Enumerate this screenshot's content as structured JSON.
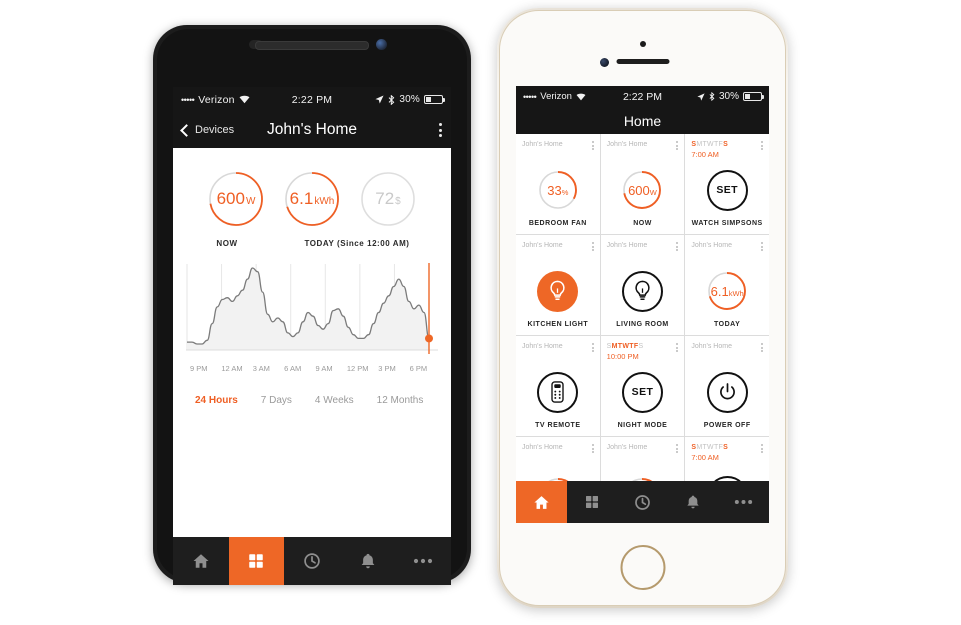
{
  "accent": "#ee6726",
  "android": {
    "status": {
      "carrier_dots": "•••••",
      "carrier": "Verizon",
      "time": "2:22 PM",
      "battery": "30%"
    },
    "header": {
      "back_label": "Devices",
      "title": "John's Home",
      "menu_icon": "kebab-menu-icon"
    },
    "gauges": [
      {
        "value": "600",
        "unit": "W",
        "pct": 72,
        "style": "orange"
      },
      {
        "value": "6.1",
        "unit": "kWh",
        "pct": 70,
        "style": "orange"
      },
      {
        "value": "72",
        "unit": "$",
        "pct": 0,
        "style": "grey"
      }
    ],
    "gauge_labels": {
      "now": "NOW",
      "today": "TODAY (Since 12:00 AM)"
    },
    "ranges": [
      {
        "label": "24 Hours",
        "active": true
      },
      {
        "label": "7 Days",
        "active": false
      },
      {
        "label": "4 Weeks",
        "active": false
      },
      {
        "label": "12 Months",
        "active": false
      }
    ],
    "tabs": [
      {
        "icon": "home-icon",
        "active": false
      },
      {
        "icon": "grid-icon",
        "active": true
      },
      {
        "icon": "clock-icon",
        "active": false
      },
      {
        "icon": "bell-icon",
        "active": false
      },
      {
        "icon": "ellipsis-icon",
        "active": false
      }
    ]
  },
  "chart_data": {
    "type": "area",
    "title": "",
    "xlabel": "",
    "ylabel": "",
    "grid": true,
    "legend": null,
    "tick_labels": [
      "9 PM",
      "12 AM",
      "3 AM",
      "6 AM",
      "9 AM",
      "12 PM",
      "3 PM",
      "6 PM"
    ],
    "ylim": [
      0,
      100
    ],
    "marker": {
      "x_label": "6 PM",
      "value": 44,
      "color": "#ee6726"
    },
    "x": [
      0,
      1,
      2,
      3,
      4,
      5,
      6,
      7,
      8,
      9,
      10,
      11,
      12,
      13,
      14,
      15,
      16,
      17,
      18,
      19,
      20,
      21,
      22,
      23,
      24,
      25,
      26,
      27,
      28,
      29,
      30,
      31,
      32,
      33,
      34,
      35,
      36,
      37,
      38,
      39,
      40,
      41,
      42,
      43,
      44,
      45,
      46,
      47,
      48
    ],
    "values": [
      42,
      42,
      41,
      41,
      43,
      52,
      61,
      65,
      66,
      64,
      67,
      70,
      76,
      82,
      80,
      69,
      57,
      53,
      55,
      53,
      47,
      45,
      47,
      53,
      58,
      56,
      51,
      49,
      52,
      59,
      60,
      56,
      50,
      46,
      44,
      44,
      46,
      52,
      58,
      63,
      67,
      72,
      76,
      72,
      64,
      60,
      62,
      58,
      44
    ]
  },
  "iphone": {
    "status": {
      "carrier_dots": "•••••",
      "carrier": "Verizon",
      "time": "2:22 PM",
      "battery": "30%"
    },
    "header": {
      "title": "Home"
    },
    "tiles": [
      {
        "source": "John's Home",
        "name": "BEDROOM FAN",
        "kind": "gauge",
        "value": "33",
        "unit": "%",
        "pct": 33,
        "style": "orange"
      },
      {
        "source": "John's Home",
        "name": "NOW",
        "kind": "gauge",
        "value": "600",
        "unit": "W",
        "pct": 72,
        "style": "orange"
      },
      {
        "schedule": {
          "days": [
            "S",
            "M",
            "T",
            "W",
            "T",
            "F",
            "S"
          ],
          "active": [
            true,
            false,
            false,
            false,
            false,
            false,
            true
          ],
          "time": "7:00 AM"
        },
        "name": "WATCH SIMPSONS",
        "kind": "set"
      },
      {
        "source": "John's Home",
        "name": "KITCHEN LIGHT",
        "kind": "bulb",
        "state": "on"
      },
      {
        "source": "John's Home",
        "name": "LIVING ROOM",
        "kind": "bulb",
        "state": "off"
      },
      {
        "source": "John's Home",
        "name": "TODAY",
        "kind": "gauge",
        "value": "6.1",
        "unit": "kWh",
        "pct": 70,
        "style": "orange"
      },
      {
        "source": "John's Home",
        "name": "TV REMOTE",
        "kind": "remote"
      },
      {
        "schedule": {
          "days": [
            "S",
            "M",
            "T",
            "W",
            "T",
            "F",
            "S"
          ],
          "active": [
            false,
            true,
            true,
            true,
            true,
            true,
            false
          ],
          "time": "10:00 PM"
        },
        "name": "NIGHT MODE",
        "kind": "set"
      },
      {
        "source": "John's Home",
        "name": "POWER OFF",
        "kind": "power"
      },
      {
        "source": "John's Home",
        "name": "",
        "kind": "gauge-partial",
        "pct": 60,
        "style": "orange"
      },
      {
        "source": "John's Home",
        "name": "",
        "kind": "gauge-partial",
        "pct": 90,
        "style": "orange"
      },
      {
        "schedule": {
          "days": [
            "S",
            "M",
            "T",
            "W",
            "T",
            "F",
            "S"
          ],
          "active": [
            true,
            false,
            false,
            false,
            false,
            false,
            true
          ],
          "time": "7:00 AM"
        },
        "name": "",
        "kind": "set-partial"
      }
    ],
    "tabs": [
      {
        "icon": "home-icon",
        "active": true
      },
      {
        "icon": "grid-icon",
        "active": false
      },
      {
        "icon": "clock-icon",
        "active": false
      },
      {
        "icon": "bell-icon",
        "active": false
      },
      {
        "icon": "ellipsis-icon",
        "active": false
      }
    ]
  }
}
